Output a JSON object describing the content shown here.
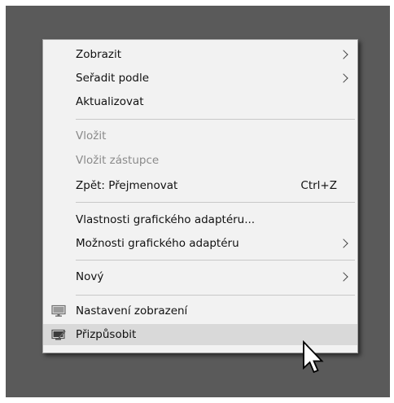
{
  "menu": {
    "items": [
      {
        "label": "Zobrazit",
        "submenu": true
      },
      {
        "label": "Seřadit podle",
        "submenu": true
      },
      {
        "label": "Aktualizovat"
      },
      {
        "label": "Vložit",
        "disabled": true
      },
      {
        "label": "Vložit zástupce",
        "disabled": true
      },
      {
        "label": "Zpět: Přejmenovat",
        "shortcut": "Ctrl+Z"
      },
      {
        "label": "Vlastnosti grafického adaptéru..."
      },
      {
        "label": "Možnosti grafického adaptéru",
        "submenu": true
      },
      {
        "label": "Nový",
        "submenu": true
      },
      {
        "label": "Nastavení zobrazení",
        "icon": "display-settings-icon"
      },
      {
        "label": "Přizpůsobit",
        "icon": "personalize-icon",
        "highlighted": true
      }
    ]
  },
  "colors": {
    "desktop": "#5a5a5a",
    "menu_background": "#f2f2f2",
    "highlight": "#d9d9d9",
    "disabled_text": "#8a8a8a"
  }
}
